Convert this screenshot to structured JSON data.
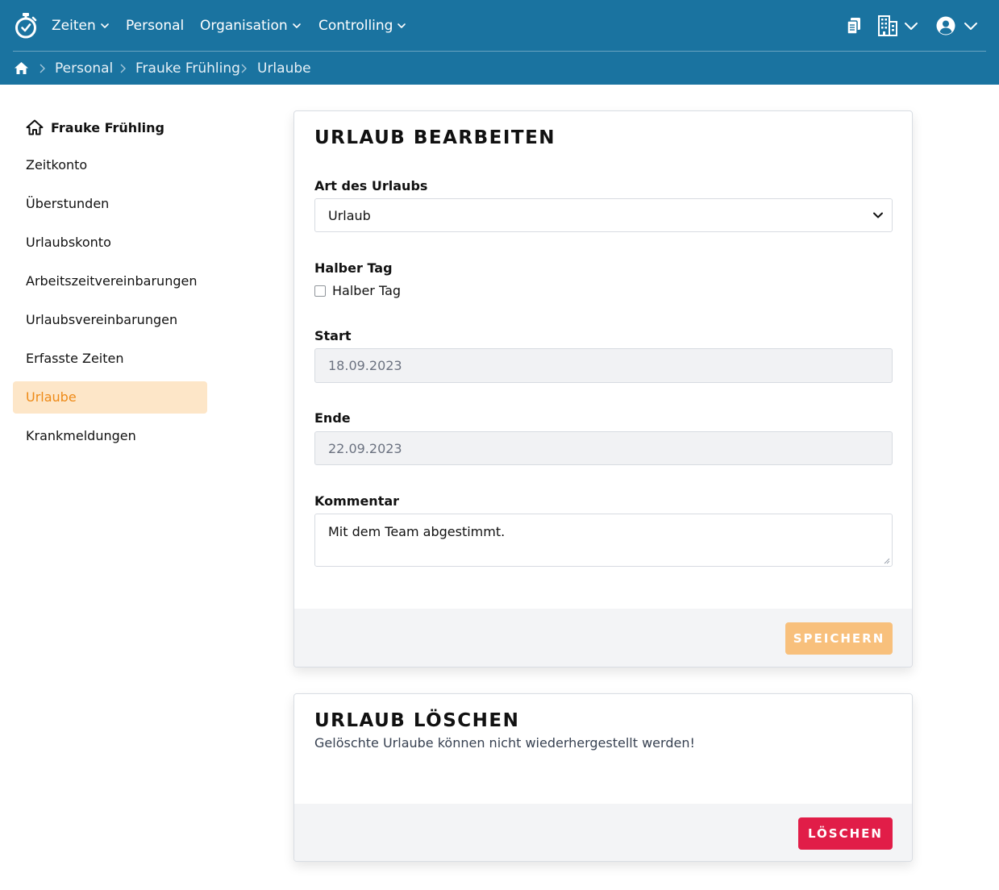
{
  "header": {
    "nav": [
      {
        "label": "Zeiten",
        "has_dropdown": true
      },
      {
        "label": "Personal",
        "has_dropdown": false
      },
      {
        "label": "Organisation",
        "has_dropdown": true
      },
      {
        "label": "Controlling",
        "has_dropdown": true
      }
    ],
    "right_icons": [
      "clipboard-icon",
      "building-icon",
      "user-circle-icon"
    ]
  },
  "breadcrumb": {
    "items": [
      "Personal",
      "Frauke Frühling",
      "Urlaube"
    ]
  },
  "sidebar": {
    "title": "Frauke Frühling",
    "items": [
      {
        "label": "Zeitkonto",
        "active": false
      },
      {
        "label": "Überstunden",
        "active": false
      },
      {
        "label": "Urlaubskonto",
        "active": false
      },
      {
        "label": "Arbeitszeitvereinbarungen",
        "active": false
      },
      {
        "label": "Urlaubsvereinbarungen",
        "active": false
      },
      {
        "label": "Erfasste Zeiten",
        "active": false
      },
      {
        "label": "Urlaube",
        "active": true
      },
      {
        "label": "Krankmeldungen",
        "active": false
      }
    ]
  },
  "edit_card": {
    "title": "URLAUB BEARBEITEN",
    "type_label": "Art des Urlaubs",
    "type_value": "Urlaub",
    "halfday_label": "Halber Tag",
    "halfday_checkbox_label": "Halber Tag",
    "halfday_checked": false,
    "start_label": "Start",
    "start_value": "18.09.2023",
    "end_label": "Ende",
    "end_value": "22.09.2023",
    "comment_label": "Kommentar",
    "comment_value": "Mit dem Team abgestimmt.",
    "save_label": "SPEICHERN"
  },
  "delete_card": {
    "title": "URLAUB LÖSCHEN",
    "warning": "Gelöschte Urlaube können nicht wiederhergestellt werden!",
    "delete_label": "LÖSCHEN"
  },
  "colors": {
    "header_bg": "#1a73a0",
    "active_bg": "#fde6c8",
    "active_text": "#ee8a17",
    "save_btn": "#f8c07c",
    "delete_btn": "#e11d48"
  }
}
